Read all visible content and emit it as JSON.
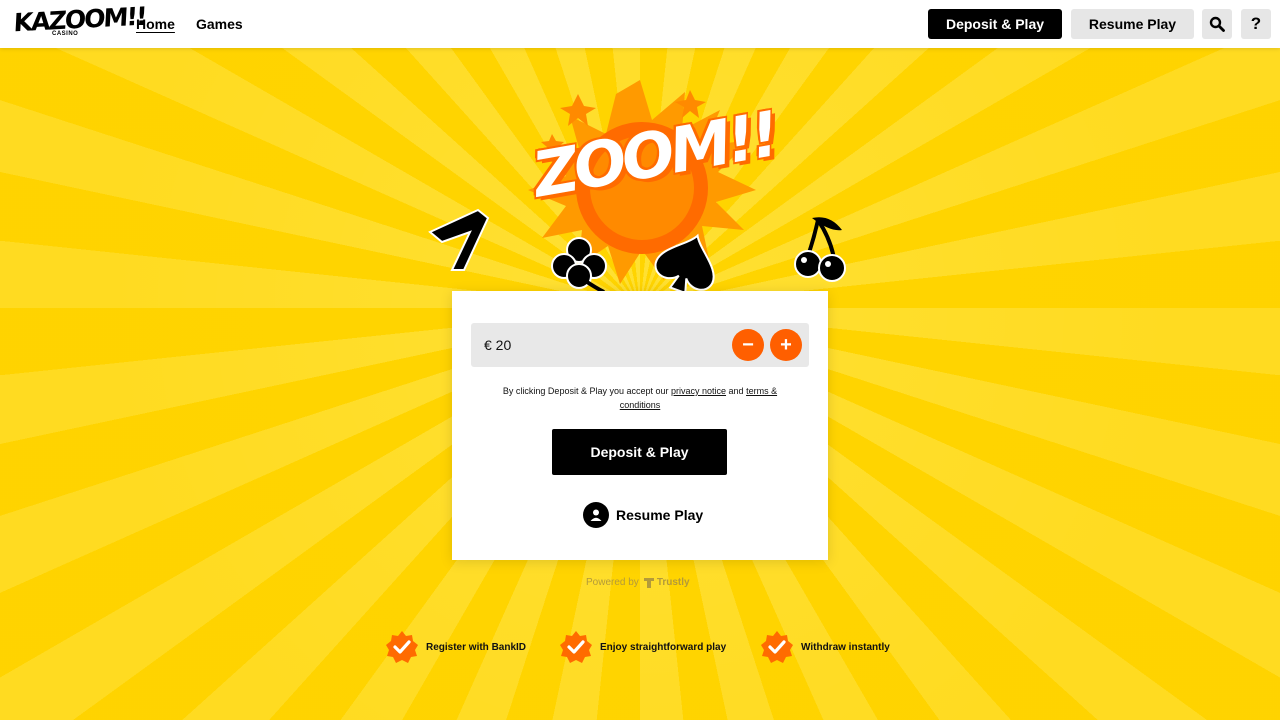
{
  "header": {
    "logo": {
      "main": "KAZOOM!!",
      "sub": "CASINO"
    },
    "nav": [
      {
        "label": "Home"
      },
      {
        "label": "Games"
      }
    ],
    "deposit_label": "Deposit & Play",
    "resume_label": "Resume Play",
    "search_icon": "search-icon",
    "help_label": "?"
  },
  "hero": {
    "title": "ZOOM!!",
    "icons": [
      "seven-icon",
      "clover-icon",
      "spade-icon",
      "cherry-icon"
    ]
  },
  "card": {
    "amount": "€ 20",
    "minus_label": "−",
    "plus_label": "+",
    "terms_prefix": "By clicking Deposit & Play you accept our ",
    "privacy_label": "privacy notice",
    "terms_mid": " and ",
    "terms_label": "terms & conditions",
    "deposit_label": "Deposit & Play",
    "resume_label": "Resume Play"
  },
  "powered": {
    "prefix": "Powered by",
    "brand": "Trustly"
  },
  "features": [
    {
      "label": "Register with BankID"
    },
    {
      "label": "Enjoy straightforward play"
    },
    {
      "label": "Withdraw instantly"
    }
  ],
  "colors": {
    "accent": "#ff5f00",
    "background": "#ffd60a",
    "dark": "#000000"
  }
}
